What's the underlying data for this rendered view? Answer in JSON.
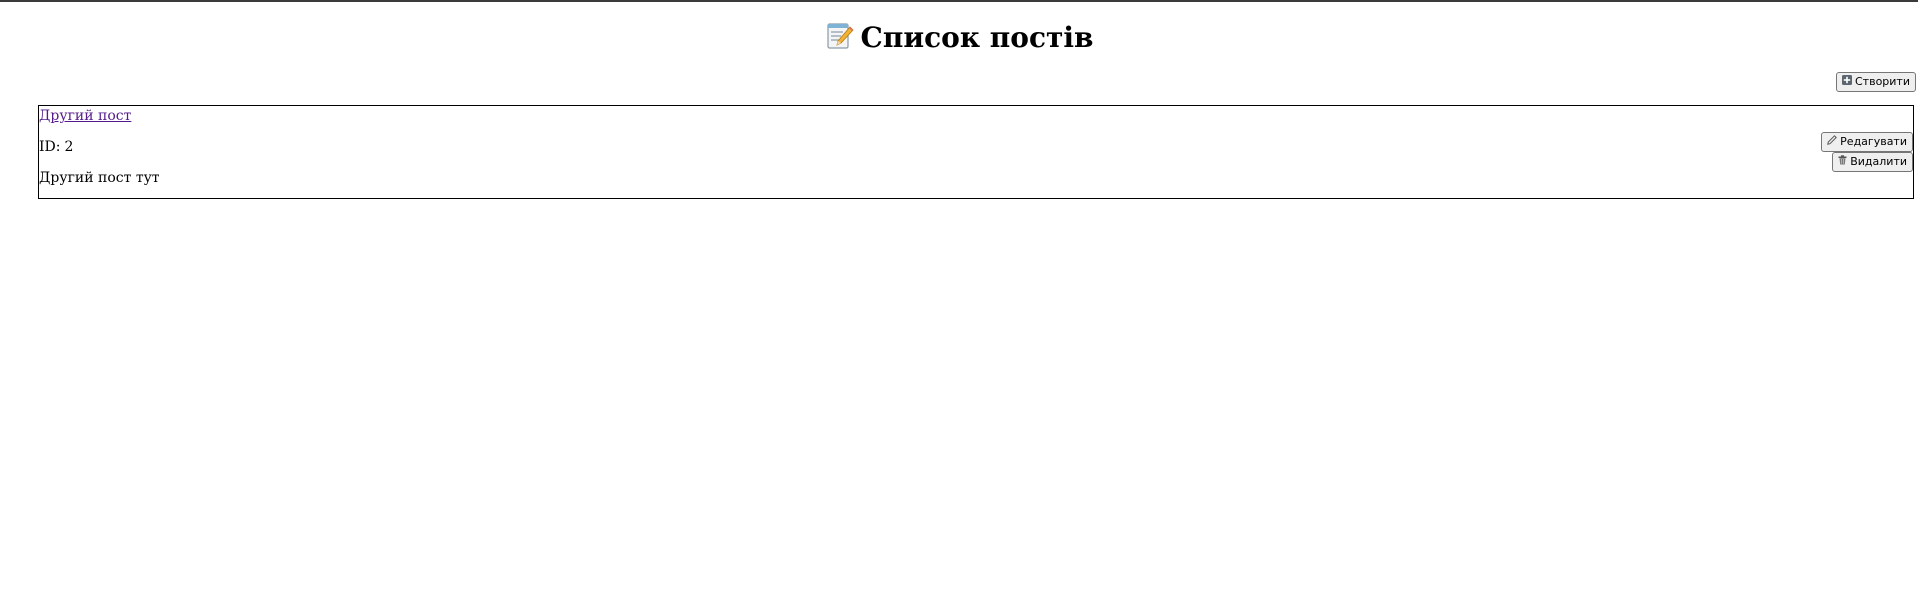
{
  "header": {
    "title": "Список постів"
  },
  "toolbar": {
    "create_label": "Створити",
    "create_icon": "plus-icon"
  },
  "posts": [
    {
      "title": "Другий пост",
      "id_label": "ID:",
      "id": "2",
      "body": "Другий пост тут",
      "edit_label": "Редагувати",
      "edit_icon": "pencil-icon",
      "delete_label": "Видалити",
      "delete_icon": "trash-icon"
    }
  ],
  "colors": {
    "link_visited": "#551a8b",
    "border": "#000000",
    "button_bg": "#efefef",
    "button_border": "#767676"
  }
}
